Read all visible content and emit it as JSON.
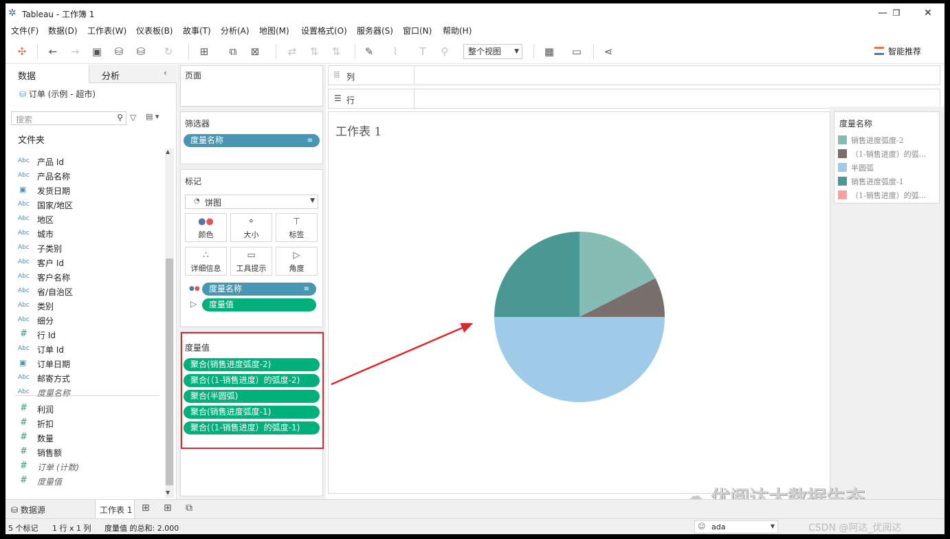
{
  "window": {
    "title": "Tableau - 工作簿 1",
    "controls": [
      "—",
      "❐",
      "✕"
    ]
  },
  "menu": [
    "文件(F)",
    "数据(D)",
    "工作表(W)",
    "仪表板(B)",
    "故事(T)",
    "分析(A)",
    "地图(M)",
    "设置格式(O)",
    "服务器(S)",
    "窗口(N)",
    "帮助(H)"
  ],
  "toolbar": {
    "fit_value": "整个视图",
    "smart_label": "智能推荐"
  },
  "left_pane": {
    "tab_data": "数据",
    "tab_analysis": "分析",
    "datasource": "订单 (示例 - 超市)",
    "search_placeholder": "搜索",
    "folders_label": "文件夹",
    "dimensions": [
      {
        "type": "Abc",
        "name": "产品 Id"
      },
      {
        "type": "Abc",
        "name": "产品名称"
      },
      {
        "type": "date",
        "name": "发货日期"
      },
      {
        "type": "Abc",
        "name": "国家/地区"
      },
      {
        "type": "Abc",
        "name": "地区"
      },
      {
        "type": "Abc",
        "name": "城市"
      },
      {
        "type": "Abc",
        "name": "子类别"
      },
      {
        "type": "Abc",
        "name": "客户 Id"
      },
      {
        "type": "Abc",
        "name": "客户名称"
      },
      {
        "type": "Abc",
        "name": "省/自治区"
      },
      {
        "type": "Abc",
        "name": "类别"
      },
      {
        "type": "Abc",
        "name": "细分"
      },
      {
        "type": "#",
        "name": "行 Id"
      },
      {
        "type": "Abc",
        "name": "订单 Id"
      },
      {
        "type": "date",
        "name": "订单日期"
      },
      {
        "type": "Abc",
        "name": "邮寄方式"
      },
      {
        "type": "Abc",
        "name": "度量名称",
        "italic": true
      }
    ],
    "measures": [
      {
        "type": "#",
        "name": "利润"
      },
      {
        "type": "#",
        "name": "折扣"
      },
      {
        "type": "#",
        "name": "数量"
      },
      {
        "type": "#",
        "name": "销售额"
      },
      {
        "type": "#",
        "name": "订单 (计数)",
        "italic": true
      },
      {
        "type": "#",
        "name": "度量值",
        "italic": true
      }
    ]
  },
  "shelves": {
    "pages": "页面",
    "filters": "筛选器",
    "filter_pill": "度量名称",
    "marks": "标记",
    "mark_type": "饼图",
    "mark_buttons": [
      "颜色",
      "大小",
      "标签",
      "详细信息",
      "工具提示",
      "角度"
    ],
    "mark_pills": [
      "度量名称",
      "度量值"
    ],
    "measure_values_title": "度量值",
    "measure_values": [
      "聚合(销售进度弧度-2)",
      "聚合(（1-销售进度）的弧度-2)",
      "聚合(半圆弧)",
      "聚合(销售进度弧度-1)",
      "聚合(（1-销售进度）的弧度-1)"
    ],
    "columns": "列",
    "rows": "行"
  },
  "view": {
    "sheet_title": "工作表 1"
  },
  "chart_data": {
    "type": "pie",
    "categories": [
      "销售进度弧度-2",
      "（1-销售进度）的弧度-2",
      "半圆弧",
      "销售进度弧度-1",
      "（1-销售进度）的弧度-1"
    ],
    "values": [
      0.35,
      0.15,
      1.0,
      0.5,
      0.0
    ],
    "colors": [
      "#86bcb6",
      "#79706e",
      "#a0cbe8",
      "#499894",
      "#ff9d9a"
    ],
    "legend_title": "度量名称",
    "legend_position": "right"
  },
  "legend": {
    "title": "度量名称",
    "items": [
      {
        "label": "销售进度弧度-2",
        "color": "#86bcb6"
      },
      {
        "label": "（1-销售进度）的弧...",
        "color": "#79706e"
      },
      {
        "label": "半圆弧",
        "color": "#a0cbe8"
      },
      {
        "label": "销售进度弧度-1",
        "color": "#499894"
      },
      {
        "label": "（1-销售进度）的弧...",
        "color": "#ff9d9a"
      }
    ]
  },
  "tabs": {
    "datasource": "数据源",
    "sheet": "工作表 1"
  },
  "status": {
    "marks": "5 个标记",
    "rowscols": "1 行 x 1 列",
    "sum": "度量值 的总和: 2.000",
    "user": "ada"
  },
  "watermark": {
    "main": "优阅达大数据生态",
    "sub": "CSDN @阿达_优阅达"
  }
}
